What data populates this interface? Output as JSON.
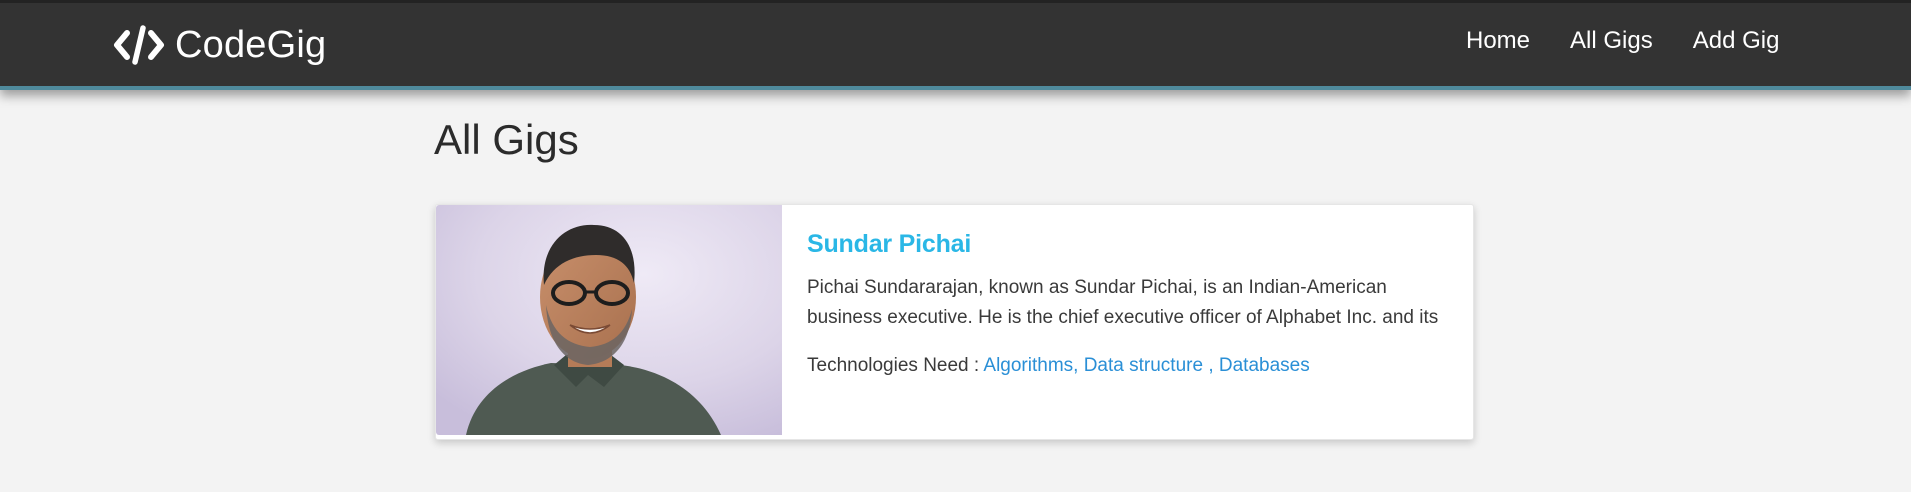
{
  "app": {
    "brand_name": "CodeGig",
    "brand_icon": "code-icon",
    "colors": {
      "navbar_bg": "#333333",
      "navbar_accent": "#4f8a9c",
      "page_bg": "#f3f3f3",
      "gig_name": "#2ab7e6",
      "tech_link": "#2a8fd6"
    }
  },
  "nav": {
    "items": [
      {
        "label": "Home"
      },
      {
        "label": "All Gigs"
      },
      {
        "label": "Add Gig"
      }
    ]
  },
  "page": {
    "title": "All Gigs"
  },
  "gigs": [
    {
      "name": "Sundar Pichai",
      "description": "Pichai Sundararajan, known as Sundar Pichai, is an Indian-American business executive. He is the chief executive officer of Alphabet Inc. and its",
      "tech_label": "Technologies Need :",
      "technologies": "Algorithms, Data structure , Databases",
      "photo_alt": "Sundar Pichai"
    }
  ]
}
